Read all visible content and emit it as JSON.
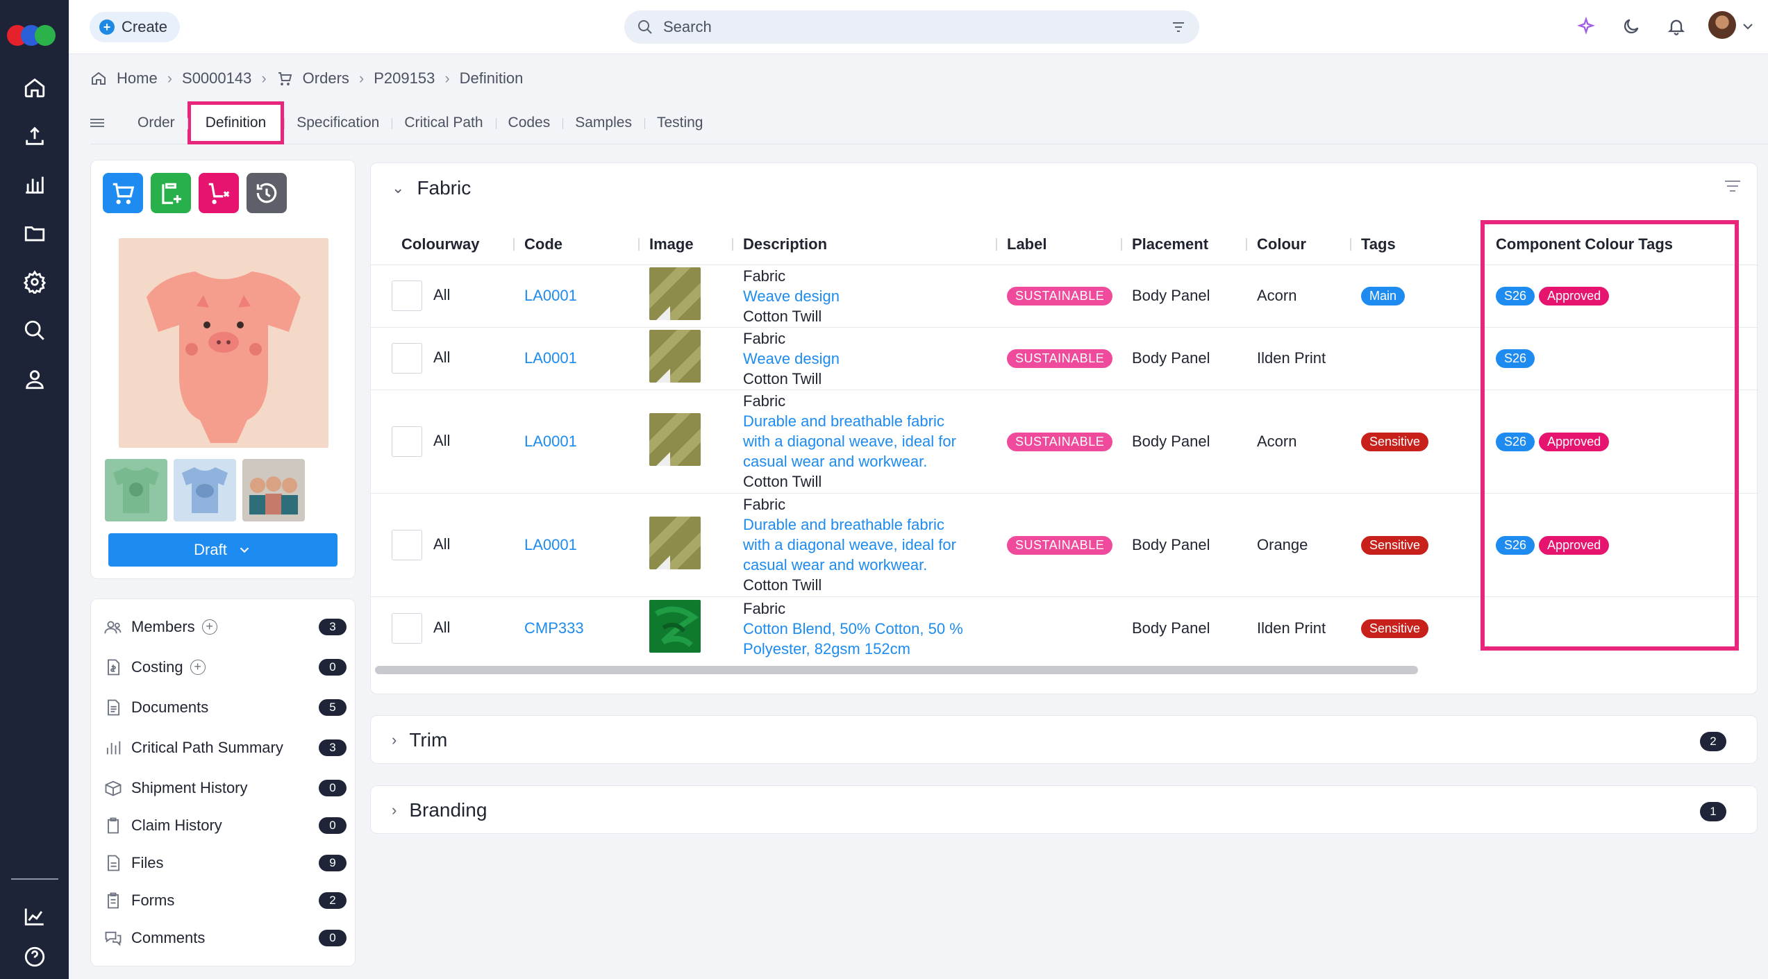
{
  "topbar": {
    "create_label": "Create",
    "search_placeholder": "Search"
  },
  "breadcrumb": [
    "Home",
    "S0000143",
    "Orders",
    "P209153",
    "Definition"
  ],
  "tabs": [
    "Order",
    "Definition",
    "Specification",
    "Critical Path",
    "Codes",
    "Samples",
    "Testing"
  ],
  "active_tab": "Definition",
  "status_button": "Draft",
  "side_menu": [
    {
      "label": "Members",
      "count": "3",
      "addable": true
    },
    {
      "label": "Costing",
      "count": "0",
      "addable": true
    },
    {
      "label": "Documents",
      "count": "5"
    },
    {
      "label": "Critical Path Summary",
      "count": "3"
    },
    {
      "label": "Shipment History",
      "count": "0"
    },
    {
      "label": "Claim History",
      "count": "0"
    },
    {
      "label": "Files",
      "count": "9"
    },
    {
      "label": "Forms",
      "count": "2"
    },
    {
      "label": "Comments",
      "count": "0"
    }
  ],
  "fabric": {
    "title": "Fabric",
    "columns": [
      "Colourway",
      "Code",
      "Image",
      "Description",
      "Label",
      "Placement",
      "Colour",
      "Tags",
      "Component Colour Tags"
    ],
    "rows": [
      {
        "colourway": "All",
        "code": "LA0001",
        "desc_top": "Fabric",
        "desc_link": "Weave design",
        "desc_bottom": "Cotton Twill",
        "label": "SUSTAINABLE",
        "placement": "Body Panel",
        "colour": "Acorn",
        "tag": "Main",
        "tag_color": "blue",
        "cc_tags": [
          "S26",
          "Approved"
        ]
      },
      {
        "colourway": "All",
        "code": "LA0001",
        "desc_top": "Fabric",
        "desc_link": "Weave design",
        "desc_bottom": "Cotton Twill",
        "label": "SUSTAINABLE",
        "placement": "Body Panel",
        "colour": "Ilden Print",
        "tag": "",
        "tag_color": "",
        "cc_tags": [
          "S26"
        ]
      },
      {
        "colourway": "All",
        "code": "LA0001",
        "desc_top": "Fabric",
        "desc_link": "Durable and breathable fabric with a diagonal weave, ideal for casual wear and workwear.",
        "desc_bottom": "Cotton Twill",
        "label": "SUSTAINABLE",
        "placement": "Body Panel",
        "colour": "Acorn",
        "tag": "Sensitive",
        "tag_color": "red",
        "cc_tags": [
          "S26",
          "Approved"
        ]
      },
      {
        "colourway": "All",
        "code": "LA0001",
        "desc_top": "Fabric",
        "desc_link": "Durable and breathable fabric with a diagonal weave, ideal for casual wear and workwear.",
        "desc_bottom": "Cotton Twill",
        "label": "SUSTAINABLE",
        "placement": "Body Panel",
        "colour": "Orange",
        "tag": "Sensitive",
        "tag_color": "red",
        "cc_tags": [
          "S26",
          "Approved"
        ]
      },
      {
        "colourway": "All",
        "code": "CMP333",
        "desc_top": "Fabric",
        "desc_link": "Cotton Blend, 50% Cotton, 50 % Polyester, 82gsm 152cm",
        "desc_bottom": "",
        "label": "",
        "placement": "Body Panel",
        "colour": "Ilden Print",
        "tag": "Sensitive",
        "tag_color": "red",
        "cc_tags": []
      }
    ]
  },
  "trim": {
    "title": "Trim",
    "count": "2"
  },
  "branding": {
    "title": "Branding",
    "count": "1"
  },
  "colors": {
    "accent": "#1d8bef",
    "highlight": "#e8277c",
    "rail": "#1d2438"
  }
}
